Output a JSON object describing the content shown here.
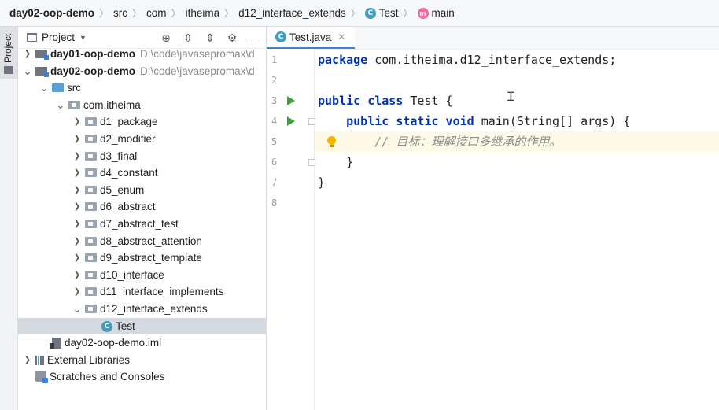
{
  "breadcrumb": {
    "project": "day02-oop-demo",
    "parts": [
      "src",
      "com",
      "itheima",
      "d12_interface_extends"
    ],
    "class_badge": "C",
    "class_name": "Test",
    "method_badge": "m",
    "method_name": "main"
  },
  "left_strip": {
    "label": "Project"
  },
  "project_panel": {
    "title": "Project",
    "tree": [
      {
        "chevron": ">",
        "label": "day01-oop-demo",
        "path": "D:\\code\\javasepromax\\d",
        "type": "module"
      },
      {
        "chevron": "v",
        "label": "day02-oop-demo",
        "path": "D:\\code\\javasepromax\\d",
        "type": "module"
      },
      {
        "chevron": "v",
        "label": "src",
        "type": "src"
      },
      {
        "chevron": "v",
        "label": "com.itheima",
        "type": "package"
      },
      {
        "chevron": ">",
        "label": "d1_package",
        "type": "package"
      },
      {
        "chevron": ">",
        "label": "d2_modifier",
        "type": "package"
      },
      {
        "chevron": ">",
        "label": "d3_final",
        "type": "package"
      },
      {
        "chevron": ">",
        "label": "d4_constant",
        "type": "package"
      },
      {
        "chevron": ">",
        "label": "d5_enum",
        "type": "package"
      },
      {
        "chevron": ">",
        "label": "d6_abstract",
        "type": "package"
      },
      {
        "chevron": ">",
        "label": "d7_abstract_test",
        "type": "package"
      },
      {
        "chevron": ">",
        "label": "d8_abstract_attention",
        "type": "package"
      },
      {
        "chevron": ">",
        "label": "d9_abstract_template",
        "type": "package"
      },
      {
        "chevron": ">",
        "label": "d10_interface",
        "type": "package"
      },
      {
        "chevron": ">",
        "label": "d11_interface_implements",
        "type": "package"
      },
      {
        "chevron": "v",
        "label": "d12_interface_extends",
        "type": "package"
      },
      {
        "chevron": "",
        "label": "Test",
        "type": "class",
        "badge": "C"
      },
      {
        "chevron": "",
        "label": "day02-oop-demo.iml",
        "type": "iml"
      },
      {
        "chevron": ">",
        "label": "External Libraries",
        "type": "libraries"
      },
      {
        "chevron": "",
        "label": "Scratches and Consoles",
        "type": "scratches"
      }
    ]
  },
  "editor": {
    "tab": {
      "badge": "C",
      "label": "Test.java"
    },
    "lines": [
      {
        "n": "1",
        "code": [
          {
            "t": "kw",
            "v": "package"
          },
          {
            "t": "",
            "v": " com.itheima.d12_interface_extends;"
          }
        ]
      },
      {
        "n": "2",
        "code": []
      },
      {
        "n": "3",
        "code": [
          {
            "t": "kw",
            "v": "public class"
          },
          {
            "t": "",
            "v": " Test {"
          }
        ]
      },
      {
        "n": "4",
        "code": [
          {
            "t": "",
            "v": "    "
          },
          {
            "t": "kw",
            "v": "public static void"
          },
          {
            "t": "",
            "v": " main(String[] args) {"
          }
        ]
      },
      {
        "n": "5",
        "code": [
          {
            "t": "",
            "v": "        "
          },
          {
            "t": "cm",
            "v": "// 目标：理解接口多继承的作用。"
          }
        ]
      },
      {
        "n": "6",
        "code": [
          {
            "t": "",
            "v": "    }"
          }
        ]
      },
      {
        "n": "7",
        "code": [
          {
            "t": "",
            "v": "}"
          }
        ]
      },
      {
        "n": "8",
        "code": []
      }
    ]
  },
  "colors": {
    "keyword": "#0033b3",
    "comment": "#8c8c8c",
    "run": "#3aa13a",
    "current_line": "#fdfbe8",
    "selection": "#d5d9e0"
  }
}
